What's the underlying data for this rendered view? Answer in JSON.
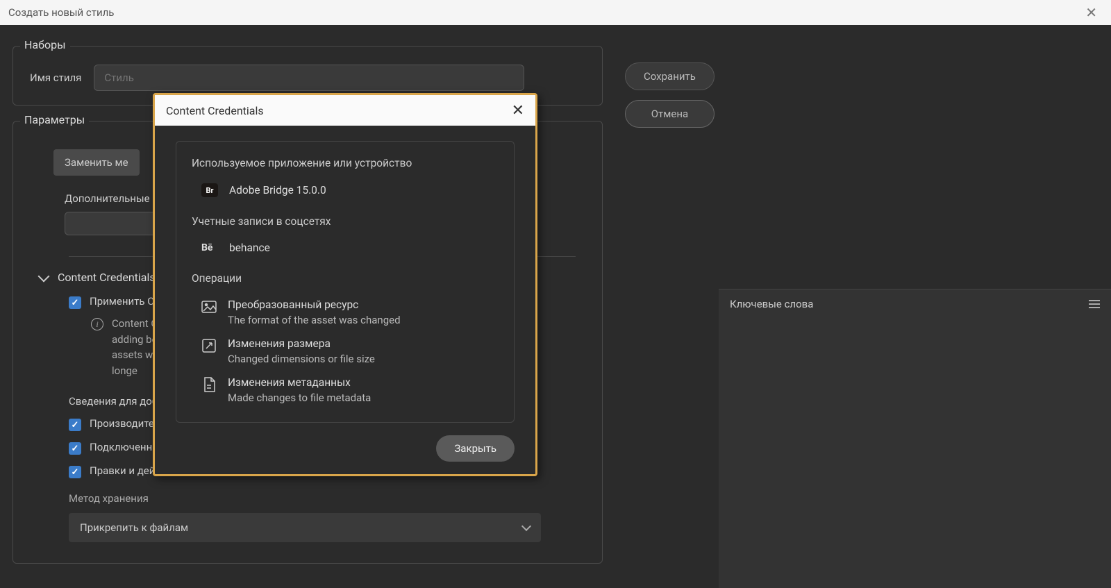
{
  "titlebar": {
    "title": "Создать новый стиль"
  },
  "buttons": {
    "save": "Сохранить",
    "cancel": "Отмена"
  },
  "sets": {
    "legend": "Наборы",
    "style_name_label": "Имя стиля",
    "style_placeholder": "Стиль"
  },
  "params": {
    "legend": "Параметры",
    "replace_btn": "Заменить ме",
    "additional_label": "Дополнительные м",
    "cc_header": "Content Credentials",
    "apply_label": "Применить Co",
    "info_text": "Content C adding be assets wil take longe",
    "subinfo_label": "Сведения для доба",
    "chk_producer": "Производителе",
    "chk_connected": "Подключенны",
    "chk_edits": "Правки и дей",
    "storage_label": "Метод хранения",
    "storage_value": "Прикрепить к файлам"
  },
  "modal": {
    "title": "Content Credentials",
    "app_section": "Используемое приложение или устройство",
    "app_name": "Adobe Bridge 15.0.0",
    "social_section": "Учетные записи в соцсетях",
    "social_account": "behance",
    "ops_section": "Операции",
    "op1_title": "Преобразованный ресурс",
    "op1_desc": "The format of the asset was changed",
    "op2_title": "Изменения размера",
    "op2_desc": "Changed dimensions or file size",
    "op3_title": "Изменения метаданных",
    "op3_desc": "Made changes to file metadata",
    "close_btn": "Закрыть"
  },
  "side_panel": {
    "title": "Ключевые слова"
  }
}
